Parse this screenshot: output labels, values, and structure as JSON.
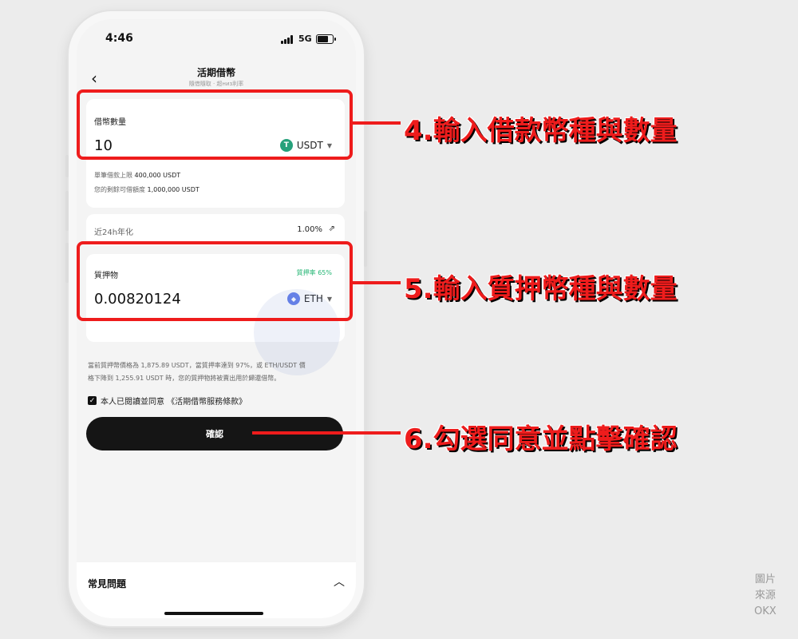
{
  "status": {
    "time": "4:46",
    "network": "5G"
  },
  "nav": {
    "title": "活期借幣",
    "subtitle": "隨借隨取 · 超низ利率"
  },
  "borrow": {
    "label": "借幣數量",
    "amount": "10",
    "coin": "USDT",
    "coin_symbol": "T",
    "coin_color": "#26a17b",
    "limit_label": "單筆借款上限",
    "limit_value": "400,000 USDT",
    "remaining_label": "您的剩餘可借額度",
    "remaining_value": "1,000,000 USDT"
  },
  "rate": {
    "label": "近24h年化",
    "value": "1.00%"
  },
  "collateral": {
    "label": "質押物",
    "ratio": "質押率 65%",
    "amount": "0.00820124",
    "coin": "ETH",
    "coin_symbol": "◆",
    "coin_color": "#627eea"
  },
  "notice": {
    "line1": "當前質押幣價格為 1,875.89 USDT，當質押率達到 97%，或 ETH/USDT 價",
    "line2": "格下降到 1,255.91 USDT 時，您的質押物將被賣出用於歸還借幣。"
  },
  "agreement": {
    "text": "本人已閱讀並同意 《活期借幣服務條款》"
  },
  "confirm_label": "確認",
  "faq_label": "常見問題",
  "annotations": {
    "step4": "4.輸入借款幣種與數量",
    "step5": "5.輸入質押幣種與數量",
    "step6": "6.勾選同意並點擊確認"
  },
  "source": {
    "line1": "圖片",
    "line2": "來源",
    "line3": "OKX"
  },
  "colors": {
    "accent": "#ee1c1c",
    "ratio_green": "#22b573",
    "button": "#151515"
  }
}
